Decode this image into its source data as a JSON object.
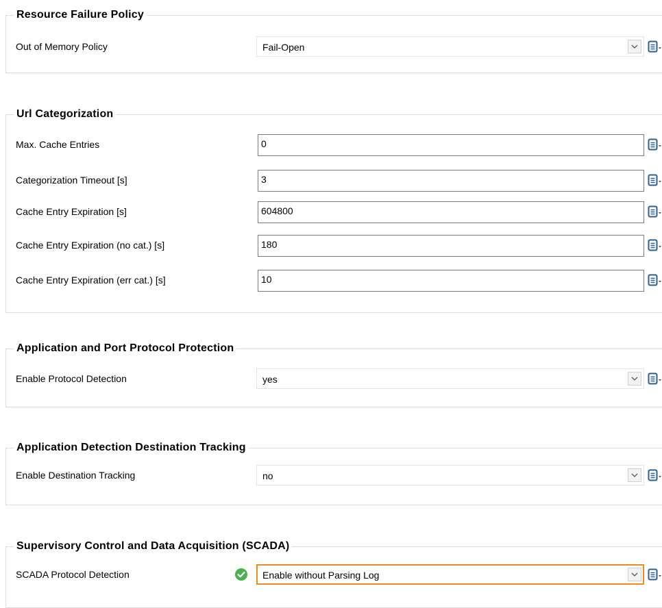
{
  "sections": [
    {
      "title": "Resource Failure Policy",
      "rows": [
        {
          "label": "Out of Memory Policy",
          "value": "Fail-Open"
        }
      ]
    },
    {
      "title": "Url Categorization",
      "rows": [
        {
          "label": "Max. Cache Entries",
          "value": "0"
        },
        {
          "label": "Categorization Timeout [s]",
          "value": "3"
        },
        {
          "label": "Cache Entry Expiration [s]",
          "value": "604800"
        },
        {
          "label": "Cache Entry Expiration (no cat.) [s]",
          "value": "180"
        },
        {
          "label": "Cache Entry Expiration (err cat.) [s]",
          "value": "10"
        }
      ]
    },
    {
      "title": "Application and Port Protocol Protection",
      "rows": [
        {
          "label": "Enable Protocol Detection",
          "value": "yes"
        }
      ]
    },
    {
      "title": "Application Detection Destination Tracking",
      "rows": [
        {
          "label": "Enable Destination Tracking",
          "value": "no"
        }
      ]
    },
    {
      "title": "Supervisory Control and Data Acquisition (SCADA)",
      "rows": [
        {
          "label": "SCADA Protocol Detection",
          "value": "Enable without Parsing Log"
        }
      ]
    }
  ],
  "icons": {
    "row_menu": "clipboard-menu-icon",
    "dropdown": "chevron-down-icon",
    "status_ok": "check-circle-icon"
  },
  "colors": {
    "focus_border": "#f08a1c",
    "status_ok": "#4caf50",
    "menu_icon": "#2e5f8a"
  }
}
